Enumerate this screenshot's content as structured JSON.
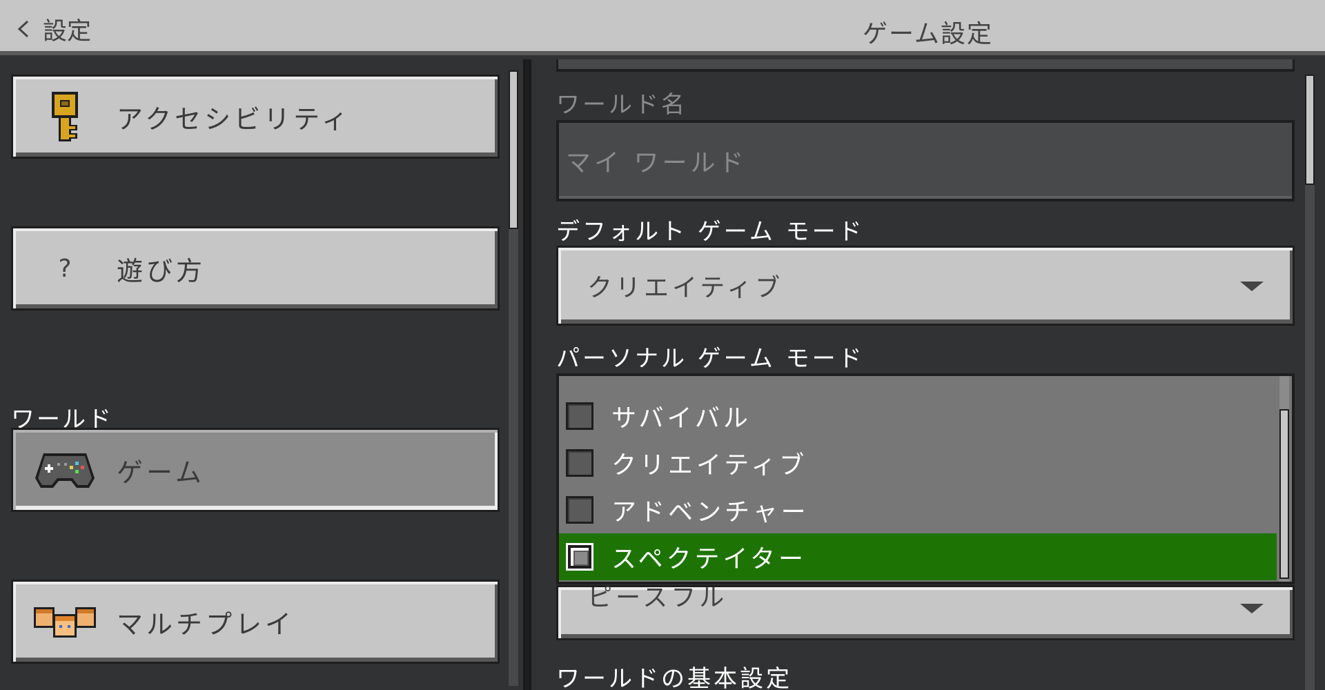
{
  "header": {
    "back_label": "設定",
    "title": "ゲーム設定"
  },
  "sidebar": {
    "items": [
      {
        "label": "アクセシビリティ",
        "icon": "key-icon"
      },
      {
        "label": "遊び方",
        "icon": "question-icon",
        "icon_text": "?"
      },
      {
        "label": "ゲーム",
        "icon": "controller-icon",
        "selected": true
      },
      {
        "label": "マルチプレイ",
        "icon": "players-icon"
      }
    ],
    "section_world": "ワールド"
  },
  "main": {
    "world_name": {
      "label": "ワールド名",
      "placeholder": "マイ ワールド"
    },
    "default_game_mode": {
      "label": "デフォルト ゲーム モード",
      "value": "クリエイティブ"
    },
    "personal_game_mode": {
      "label": "パーソナル ゲーム モード",
      "options": [
        {
          "label": "サバイバル",
          "checked": false
        },
        {
          "label": "クリエイティブ",
          "checked": false
        },
        {
          "label": "アドベンチャー",
          "checked": false
        },
        {
          "label": "スペクテイター",
          "checked": true
        }
      ]
    },
    "difficulty": {
      "value": "ピースフル"
    },
    "world_preferences": {
      "label": "ワールドの基本設定"
    }
  },
  "colors": {
    "panel": "#313233",
    "button": "#c6c6c6",
    "selected_button": "#8b8b8b",
    "accent_green": "#1d7404",
    "header": "#c6c6c6"
  }
}
